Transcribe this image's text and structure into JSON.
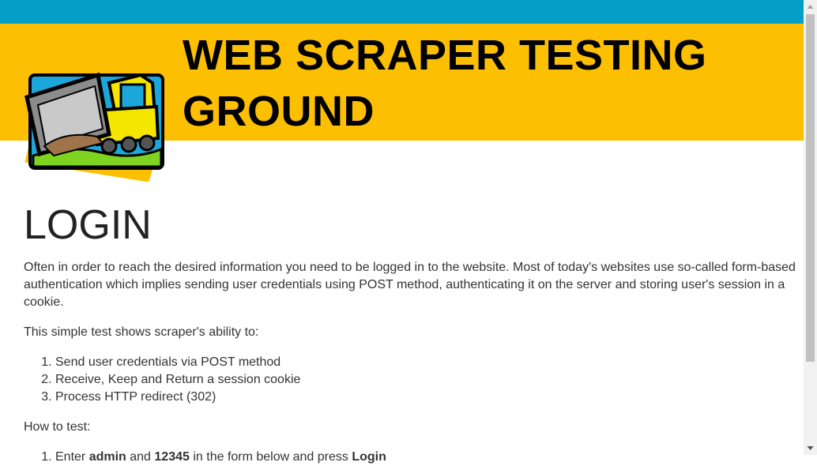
{
  "header": {
    "title_line1": "WEB SCRAPER TESTING",
    "title_line2": "GROUND",
    "logo_icon": "bulldozer-icon",
    "topbar_color": "#039fc7",
    "banner_color": "#fdbf01"
  },
  "main": {
    "heading": "LOGIN",
    "intro": "Often in order to reach the desired information you need to be logged in to the website. Most of today's websites use so-called form-based authentication which implies sending user credentials using POST method, authenticating it on the server and storing user's session in a cookie.",
    "lead": "This simple test shows scraper's ability to:",
    "abilities": [
      "Send user credentials via POST method",
      "Receive, Keep and Return a session cookie",
      "Process HTTP redirect (302)"
    ],
    "how_to_test": "How to test:",
    "step1": {
      "prefix": "Enter ",
      "user": "admin",
      "and": " and ",
      "password": "12345",
      "middle": " in the form below and press ",
      "button": "Login"
    }
  }
}
